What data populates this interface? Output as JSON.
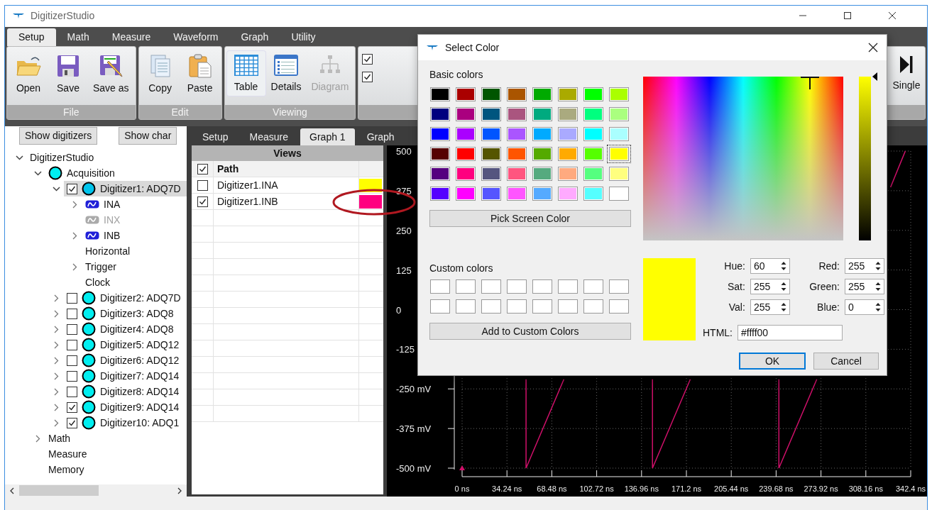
{
  "window": {
    "title": "DigitizerStudio"
  },
  "menu_tabs": [
    {
      "label": "Setup",
      "selected": true
    },
    {
      "label": "Math",
      "selected": false
    },
    {
      "label": "Measure",
      "selected": false
    },
    {
      "label": "Waveform",
      "selected": false
    },
    {
      "label": "Graph",
      "selected": false
    },
    {
      "label": "Utility",
      "selected": false
    }
  ],
  "ribbon": {
    "groups": [
      {
        "label": "File",
        "buttons": [
          {
            "label": "Open",
            "kind": "folder",
            "selected": false,
            "disabled": false
          },
          {
            "label": "Save",
            "kind": "floppy",
            "selected": false,
            "disabled": false
          },
          {
            "label": "Save as",
            "kind": "floppy-pencil",
            "selected": false,
            "disabled": false
          }
        ]
      },
      {
        "label": "Edit",
        "buttons": [
          {
            "label": "Copy",
            "kind": "copy",
            "selected": false,
            "disabled": false
          },
          {
            "label": "Paste",
            "kind": "paste",
            "selected": false,
            "disabled": false
          }
        ]
      },
      {
        "label": "Viewing",
        "buttons": [
          {
            "label": "Table",
            "kind": "table",
            "selected": true,
            "disabled": false
          },
          {
            "label": "Details",
            "kind": "details",
            "selected": false,
            "disabled": false
          },
          {
            "label": "Diagram",
            "kind": "diagram",
            "selected": false,
            "disabled": true
          }
        ]
      }
    ],
    "checkboxes": [
      {
        "checked": true
      },
      {
        "checked": true
      }
    ],
    "single_button": {
      "label": "Single"
    }
  },
  "left_panel": {
    "buttons": [
      "Show digitizers",
      "Show char"
    ],
    "tree": [
      {
        "kind": "section",
        "label": "DigitizerStudio",
        "expanded": true,
        "selected": false,
        "children": [
          {
            "kind": "group",
            "label": "Acquisition",
            "expanded": true,
            "selected": false,
            "children": [
              {
                "kind": "digitizer",
                "label": "Digitizer1: ADQ7D",
                "expanded": true,
                "checked": true,
                "selected": true,
                "children": [
                  {
                    "kind": "channel",
                    "label": "INA",
                    "expanded": false,
                    "disabled": false,
                    "selected": false
                  },
                  {
                    "kind": "channel",
                    "label": "INX",
                    "disabled": true,
                    "selected": false
                  },
                  {
                    "kind": "channel",
                    "label": "INB",
                    "expanded": false,
                    "disabled": false,
                    "selected": false
                  },
                  {
                    "kind": "section",
                    "label": "Horizontal",
                    "selected": false
                  },
                  {
                    "kind": "section",
                    "label": "Trigger",
                    "expanded": false,
                    "selected": false
                  },
                  {
                    "kind": "section",
                    "label": "Clock",
                    "selected": false
                  }
                ]
              },
              {
                "kind": "digitizer",
                "label": "Digitizer2: ADQ7D",
                "expanded": false,
                "checked": false,
                "selected": false
              },
              {
                "kind": "digitizer",
                "label": "Digitizer3: ADQ8",
                "expanded": false,
                "checked": false,
                "selected": false
              },
              {
                "kind": "digitizer",
                "label": "Digitizer4: ADQ8",
                "expanded": false,
                "checked": false,
                "selected": false
              },
              {
                "kind": "digitizer",
                "label": "Digitizer5: ADQ12",
                "expanded": false,
                "checked": false,
                "selected": false
              },
              {
                "kind": "digitizer",
                "label": "Digitizer6: ADQ12",
                "expanded": false,
                "checked": false,
                "selected": false
              },
              {
                "kind": "digitizer",
                "label": "Digitizer7: ADQ14",
                "expanded": false,
                "checked": false,
                "selected": false
              },
              {
                "kind": "digitizer",
                "label": "Digitizer8: ADQ14",
                "expanded": false,
                "checked": false,
                "selected": false
              },
              {
                "kind": "digitizer",
                "label": "Digitizer9: ADQ14",
                "expanded": false,
                "checked": true,
                "selected": false
              },
              {
                "kind": "digitizer",
                "label": "Digitizer10: ADQ1",
                "expanded": false,
                "checked": true,
                "selected": false
              }
            ]
          },
          {
            "kind": "section",
            "label": "Math",
            "expanded": false,
            "selected": false
          },
          {
            "kind": "section",
            "label": "Measure",
            "selected": false
          },
          {
            "kind": "section",
            "label": "Memory",
            "selected": false
          }
        ]
      }
    ]
  },
  "panel_tabs": [
    {
      "label": "Setup",
      "selected": false
    },
    {
      "label": "Measure",
      "selected": false
    },
    {
      "label": "Graph 1",
      "selected": true
    },
    {
      "label": "Graph",
      "selected": false
    }
  ],
  "views_table": {
    "title": "Views",
    "header_checked": true,
    "columns": [
      "Path"
    ],
    "rows": [
      {
        "path": "Digitizer1.INA",
        "checked": false,
        "color": "#ffff00",
        "circled": false
      },
      {
        "path": "Digitizer1.INB",
        "checked": true,
        "color": "#ff0080",
        "circled": true
      }
    ]
  },
  "chart": {
    "chart_data": {
      "type": "line",
      "grid": true,
      "x": [
        48.8,
        48.8,
        77.7,
        145.3,
        145.3,
        174.2,
        241.8,
        241.8,
        270.7,
        327,
        338.3
      ],
      "series": [
        {
          "color": "#d0106a",
          "values": [
            -220,
            -500,
            -220,
            null,
            null,
            null,
            null,
            null,
            null,
            null,
            null
          ]
        },
        {
          "color": "#d0106a",
          "values": [
            null,
            null,
            null,
            -220,
            -500,
            -220,
            null,
            null,
            null,
            null,
            null
          ]
        },
        {
          "color": "#d0106a",
          "values": [
            null,
            null,
            null,
            null,
            null,
            null,
            -220,
            -500,
            -220,
            null,
            null
          ]
        },
        {
          "color": "#d0106a",
          "values": [
            null,
            null,
            null,
            null,
            null,
            null,
            null,
            null,
            null,
            386,
            500
          ]
        }
      ],
      "xlim": [
        0,
        342.4
      ],
      "ylim": [
        -500,
        500
      ],
      "xticks": [
        {
          "value": 0,
          "label": "0 ns"
        },
        {
          "value": 34.24,
          "label": "34.24 ns"
        },
        {
          "value": 68.48,
          "label": "68.48 ns"
        },
        {
          "value": 102.72,
          "label": "102.72 ns"
        },
        {
          "value": 136.96,
          "label": "136.96 ns"
        },
        {
          "value": 171.2,
          "label": "171.2 ns"
        },
        {
          "value": 205.44,
          "label": "205.44 ns"
        },
        {
          "value": 239.68,
          "label": "239.68 ns"
        },
        {
          "value": 273.92,
          "label": "273.92 ns"
        },
        {
          "value": 308.16,
          "label": "308.16 ns"
        },
        {
          "value": 342.4,
          "label": "342.4 ns"
        }
      ],
      "yticks": [
        {
          "value": 500,
          "label": "500"
        },
        {
          "value": 375,
          "label": "375"
        },
        {
          "value": 250,
          "label": "250"
        },
        {
          "value": 125,
          "label": "125"
        },
        {
          "value": 0,
          "label": "0"
        },
        {
          "value": -125,
          "label": "-125"
        },
        {
          "value": -250,
          "label": "-250 mV"
        },
        {
          "value": -375,
          "label": "-375 mV"
        },
        {
          "value": -500,
          "label": "-500 mV"
        }
      ]
    }
  },
  "dialog": {
    "title": "Select Color",
    "basic_colors_label": "Basic colors",
    "basic_colors": [
      {
        "color": "#000000",
        "selected": false
      },
      {
        "color": "#aa0000",
        "selected": false
      },
      {
        "color": "#005500",
        "selected": false
      },
      {
        "color": "#aa5500",
        "selected": false
      },
      {
        "color": "#00aa00",
        "selected": false
      },
      {
        "color": "#aaaa00",
        "selected": false
      },
      {
        "color": "#00ff00",
        "selected": false
      },
      {
        "color": "#aaff00",
        "selected": false
      },
      {
        "color": "#00007f",
        "selected": false
      },
      {
        "color": "#aa007f",
        "selected": false
      },
      {
        "color": "#00557f",
        "selected": false
      },
      {
        "color": "#aa557f",
        "selected": false
      },
      {
        "color": "#00aa7f",
        "selected": false
      },
      {
        "color": "#aaaa7f",
        "selected": false
      },
      {
        "color": "#00ff7f",
        "selected": false
      },
      {
        "color": "#aaff7f",
        "selected": false
      },
      {
        "color": "#0000ff",
        "selected": false
      },
      {
        "color": "#aa00ff",
        "selected": false
      },
      {
        "color": "#0055ff",
        "selected": false
      },
      {
        "color": "#aa55ff",
        "selected": false
      },
      {
        "color": "#00aaff",
        "selected": false
      },
      {
        "color": "#aaaaff",
        "selected": false
      },
      {
        "color": "#00ffff",
        "selected": false
      },
      {
        "color": "#aaffff",
        "selected": false
      },
      {
        "color": "#550000",
        "selected": false
      },
      {
        "color": "#ff0000",
        "selected": false
      },
      {
        "color": "#555500",
        "selected": false
      },
      {
        "color": "#ff5500",
        "selected": false
      },
      {
        "color": "#55aa00",
        "selected": false
      },
      {
        "color": "#ffaa00",
        "selected": false
      },
      {
        "color": "#55ff00",
        "selected": false
      },
      {
        "color": "#ffff00",
        "selected": true
      },
      {
        "color": "#55007f",
        "selected": false
      },
      {
        "color": "#ff007f",
        "selected": false
      },
      {
        "color": "#55557f",
        "selected": false
      },
      {
        "color": "#ff557f",
        "selected": false
      },
      {
        "color": "#55aa7f",
        "selected": false
      },
      {
        "color": "#ffaa7f",
        "selected": false
      },
      {
        "color": "#55ff7f",
        "selected": false
      },
      {
        "color": "#ffff7f",
        "selected": false
      },
      {
        "color": "#5500ff",
        "selected": false
      },
      {
        "color": "#ff00ff",
        "selected": false
      },
      {
        "color": "#5555ff",
        "selected": false
      },
      {
        "color": "#ff55ff",
        "selected": false
      },
      {
        "color": "#55aaff",
        "selected": false
      },
      {
        "color": "#ffaaff",
        "selected": false
      },
      {
        "color": "#55ffff",
        "selected": false
      },
      {
        "color": "#ffffff",
        "selected": false
      }
    ],
    "pick_button": "Pick Screen Color",
    "custom_colors_label": "Custom colors",
    "custom_colors": [
      {
        "color": "#ffffff"
      },
      {
        "color": "#ffffff"
      },
      {
        "color": "#ffffff"
      },
      {
        "color": "#ffffff"
      },
      {
        "color": "#ffffff"
      },
      {
        "color": "#ffffff"
      },
      {
        "color": "#ffffff"
      },
      {
        "color": "#ffffff"
      },
      {
        "color": "#ffffff"
      },
      {
        "color": "#ffffff"
      },
      {
        "color": "#ffffff"
      },
      {
        "color": "#ffffff"
      },
      {
        "color": "#ffffff"
      },
      {
        "color": "#ffffff"
      },
      {
        "color": "#ffffff"
      },
      {
        "color": "#ffffff"
      }
    ],
    "add_button": "Add to Custom Colors",
    "spectrum": {
      "level": 0.833
    },
    "value_slider": {
      "level": 1
    },
    "fields": [
      {
        "label": "Hue:",
        "value": "60"
      },
      {
        "label": "Red:",
        "value": "255"
      },
      {
        "label": "Sat:",
        "value": "255"
      },
      {
        "label": "Green:",
        "value": "255"
      },
      {
        "label": "Val:",
        "value": "255"
      },
      {
        "label": "Blue:",
        "value": "0"
      }
    ],
    "html_label": "HTML:",
    "html_value": "#ffff00",
    "buttons": [
      {
        "label": "OK",
        "default": true
      },
      {
        "label": "Cancel",
        "default": false
      }
    ]
  }
}
